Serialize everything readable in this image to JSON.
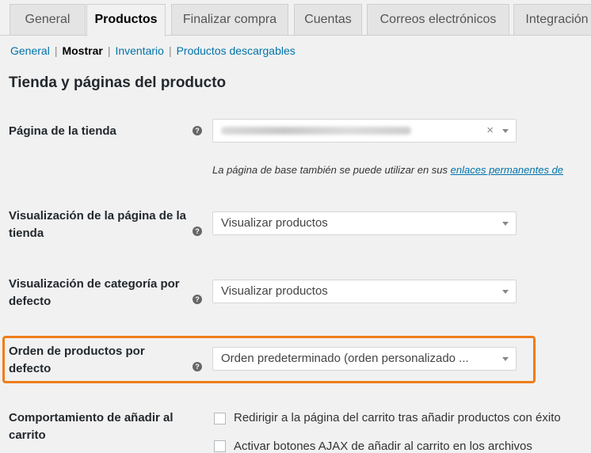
{
  "tabs": [
    {
      "label": "General"
    },
    {
      "label": "Productos"
    },
    {
      "label": "Finalizar compra"
    },
    {
      "label": "Cuentas"
    },
    {
      "label": "Correos electrónicos"
    },
    {
      "label": "Integración"
    }
  ],
  "subnav": {
    "general": "General",
    "display": "Mostrar",
    "inventory": "Inventario",
    "downloadable": "Productos descargables",
    "separator": "|"
  },
  "section_title": "Tienda y páginas del producto",
  "help_glyph": "?",
  "fields": {
    "shop_page": {
      "label": "Página de la tienda",
      "clear": "×",
      "description_text": "La página de base también se puede utilizar en sus ",
      "description_link": "enlaces permanentes de"
    },
    "shop_display": {
      "label": "Visualización de la página de la tienda",
      "value": "Visualizar productos"
    },
    "category_display": {
      "label": "Visualización de categoría por defecto",
      "value": "Visualizar productos"
    },
    "default_sorting": {
      "label": "Orden de productos por defecto",
      "value": "Orden predeterminado (orden personalizado ..."
    },
    "add_to_cart": {
      "label": "Comportamiento de añadir al carrito",
      "option1": "Redirigir a la página del carrito tras añadir productos con éxito",
      "option2": "Activar botones AJAX de añadir al carrito en los archivos"
    }
  },
  "colors": {
    "highlight": "#ef7d1a",
    "link": "#0073aa"
  }
}
